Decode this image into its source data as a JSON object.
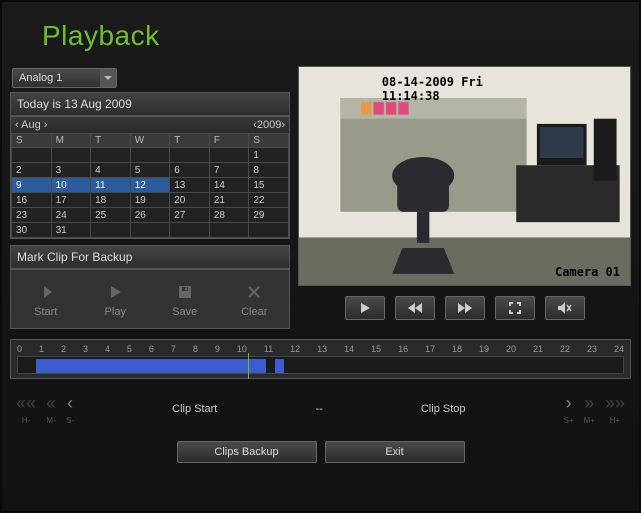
{
  "title": "Playback",
  "channel_select": "Analog 1",
  "date_label": "Today is 13 Aug 2009",
  "calendar": {
    "month": "Aug",
    "year": "2009",
    "weekdays": [
      "S",
      "M",
      "T",
      "W",
      "T",
      "F",
      "S"
    ],
    "rows": [
      [
        {
          "n": "",
          "dim": true
        },
        {
          "n": "",
          "dim": true
        },
        {
          "n": "",
          "dim": true
        },
        {
          "n": "",
          "dim": true
        },
        {
          "n": "",
          "dim": true
        },
        {
          "n": "",
          "dim": true
        },
        {
          "n": "1"
        }
      ],
      [
        {
          "n": "2"
        },
        {
          "n": "3"
        },
        {
          "n": "4"
        },
        {
          "n": "5"
        },
        {
          "n": "6"
        },
        {
          "n": "7"
        },
        {
          "n": "8"
        }
      ],
      [
        {
          "n": "9",
          "sel": true
        },
        {
          "n": "10",
          "sel": true
        },
        {
          "n": "11",
          "sel": true
        },
        {
          "n": "12",
          "sel": true
        },
        {
          "n": "13"
        },
        {
          "n": "14"
        },
        {
          "n": "15"
        }
      ],
      [
        {
          "n": "16"
        },
        {
          "n": "17"
        },
        {
          "n": "18"
        },
        {
          "n": "19"
        },
        {
          "n": "20"
        },
        {
          "n": "21"
        },
        {
          "n": "22"
        }
      ],
      [
        {
          "n": "23"
        },
        {
          "n": "24"
        },
        {
          "n": "25"
        },
        {
          "n": "26"
        },
        {
          "n": "27"
        },
        {
          "n": "28"
        },
        {
          "n": "29"
        }
      ],
      [
        {
          "n": "30"
        },
        {
          "n": "31"
        },
        {
          "n": "",
          "dim": true
        },
        {
          "n": "",
          "dim": true
        },
        {
          "n": "",
          "dim": true
        },
        {
          "n": "",
          "dim": true
        },
        {
          "n": "",
          "dim": true
        }
      ]
    ]
  },
  "mark_clip_label": "Mark Clip For Backup",
  "backup_buttons": {
    "start": "Start",
    "play": "Play",
    "save": "Save",
    "clear": "Clear"
  },
  "video": {
    "timestamp": "08-14-2009 Fri 11:14:38",
    "camera": "Camera 01"
  },
  "timeline": {
    "hours": [
      "0",
      "1",
      "2",
      "3",
      "4",
      "5",
      "6",
      "7",
      "8",
      "9",
      "10",
      "11",
      "12",
      "13",
      "14",
      "15",
      "16",
      "17",
      "18",
      "19",
      "20",
      "21",
      "22",
      "23",
      "24"
    ],
    "segments": [
      {
        "start_pct": 3,
        "end_pct": 41
      },
      {
        "start_pct": 42.5,
        "end_pct": 44
      }
    ],
    "cursor_pct": 38
  },
  "clipbar": {
    "start": "Clip Start",
    "sep": "--",
    "stop": "Clip Stop",
    "nav": {
      "hminus": "H-",
      "mminus": "M-",
      "sminus": "S-",
      "splus": "S+",
      "mplus": "M+",
      "hplus": "H+"
    }
  },
  "bottom": {
    "clips_backup": "Clips Backup",
    "exit": "Exit"
  }
}
